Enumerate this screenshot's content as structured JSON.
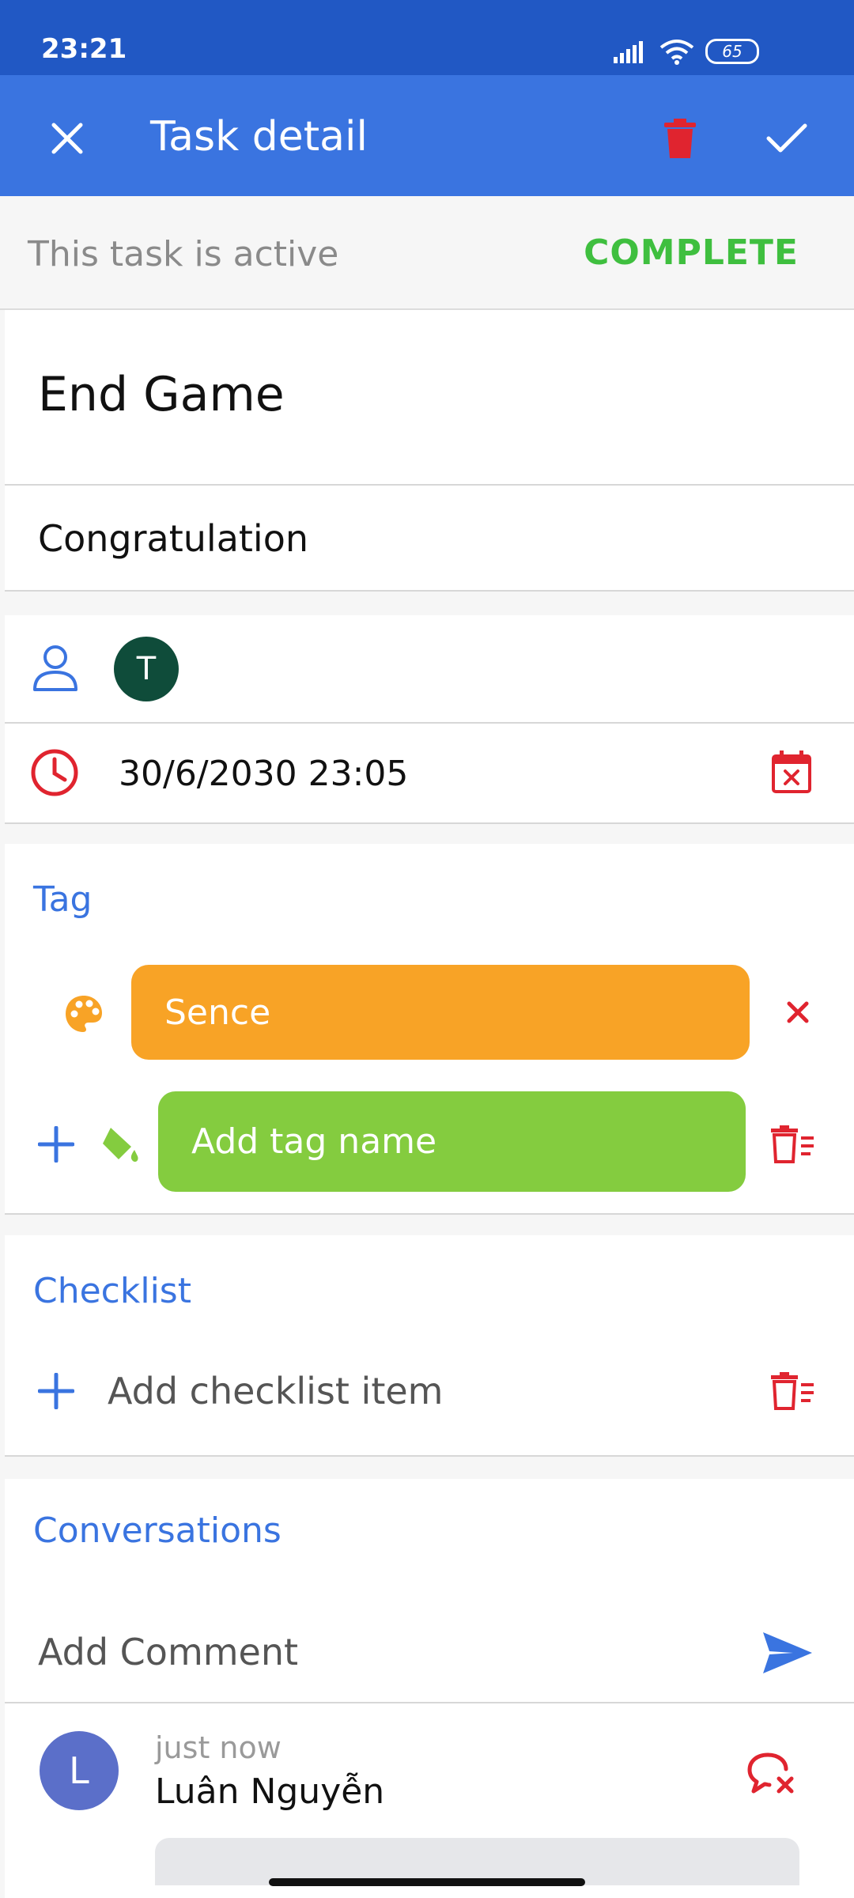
{
  "status_bar": {
    "time": "23:21",
    "battery": "65"
  },
  "app_bar": {
    "title": "Task detail",
    "close_icon": "close-icon",
    "delete_icon": "trash-icon",
    "confirm_icon": "check-icon"
  },
  "task_status": {
    "text": "This task is active",
    "action": "COMPLETE"
  },
  "task": {
    "title": "End Game",
    "description": "Congratulation"
  },
  "assignee": {
    "initial": "T",
    "avatar_color": "#0f4c3a"
  },
  "due": {
    "datetime": "30/6/2030 23:05"
  },
  "tags": {
    "label": "Tag",
    "items": [
      {
        "name": "Sence",
        "color": "#f8a326"
      }
    ],
    "new_tag": {
      "placeholder": "Add tag name",
      "color": "#84cc3f"
    }
  },
  "checklist": {
    "label": "Checklist",
    "placeholder": "Add checklist item"
  },
  "conversations": {
    "label": "Conversations",
    "comment_placeholder": "Add Comment",
    "comments": [
      {
        "initial": "L",
        "time": "just now",
        "author": "Luân Nguyễn"
      }
    ]
  },
  "colors": {
    "primary": "#3a74e0",
    "danger": "#e0242f",
    "success": "#3fbf3f"
  }
}
